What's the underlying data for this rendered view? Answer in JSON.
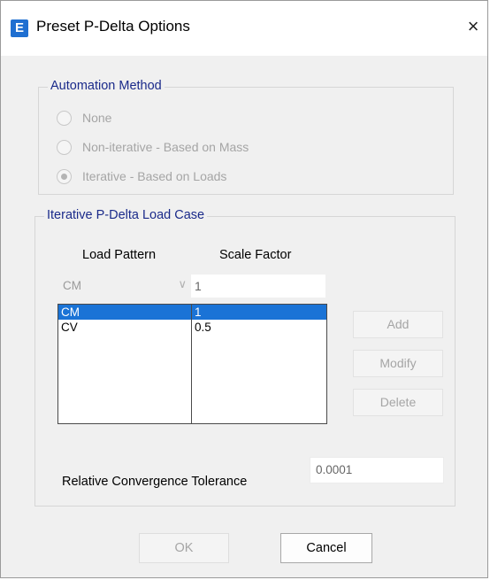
{
  "window": {
    "title": "Preset P-Delta Options",
    "app_icon_letter": "E",
    "close_symbol": "×"
  },
  "automation": {
    "legend": "Automation Method",
    "options": [
      {
        "label": "None",
        "checked": false,
        "enabled": false
      },
      {
        "label": "Non-iterative - Based on Mass",
        "checked": false,
        "enabled": false
      },
      {
        "label": "Iterative - Based on Loads",
        "checked": true,
        "enabled": false
      }
    ]
  },
  "load_case": {
    "legend": "Iterative P-Delta Load Case",
    "col_pattern": "Load Pattern",
    "col_scale": "Scale Factor",
    "pattern_select_value": "CM",
    "scale_input_value": "1",
    "rows": [
      {
        "pattern": "CM",
        "scale": "1",
        "selected": true
      },
      {
        "pattern": "CV",
        "scale": "0.5",
        "selected": false
      }
    ],
    "add_label": "Add",
    "modify_label": "Modify",
    "delete_label": "Delete",
    "tolerance_label": "Relative Convergence Tolerance",
    "tolerance_value": "0.0001"
  },
  "footer": {
    "ok_label": "OK",
    "cancel_label": "Cancel"
  }
}
